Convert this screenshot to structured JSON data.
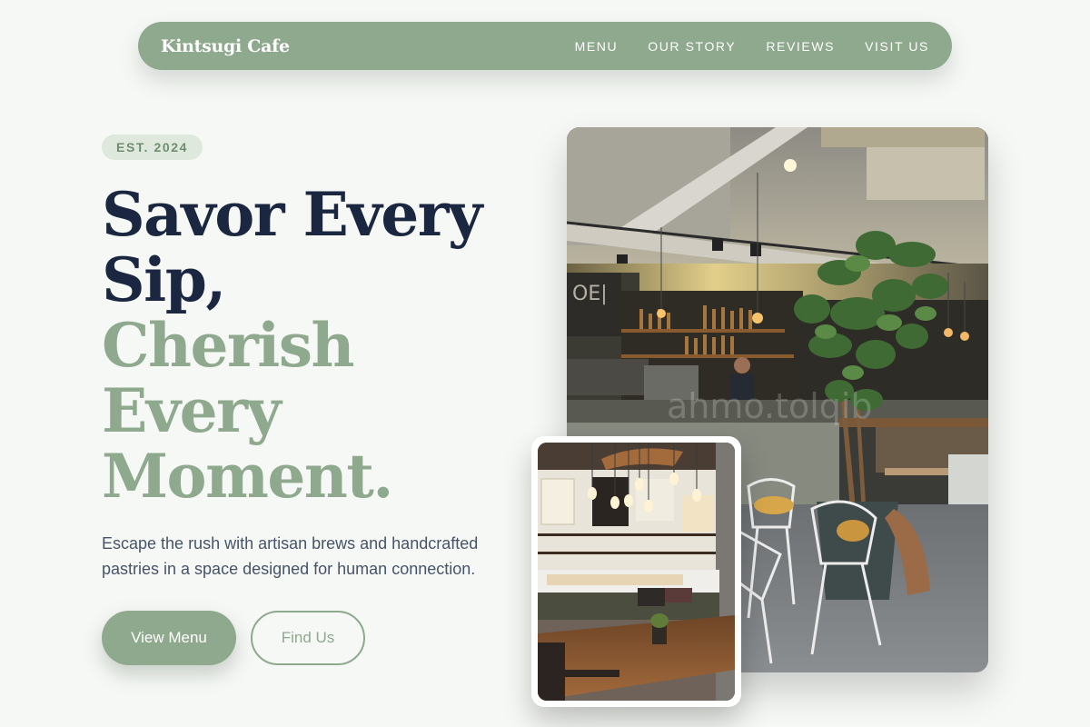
{
  "nav": {
    "brand": "Kintsugi Cafe",
    "links": [
      "MENU",
      "OUR STORY",
      "REVIEWS",
      "VISIT US"
    ]
  },
  "hero": {
    "badge": "EST. 2024",
    "headline_dark": "Savor Every Sip,",
    "headline_green": "Cherish Every Moment.",
    "subtext": "Escape the rush with artisan brews and handcrafted pastries in a space designed for human connection.",
    "primary_button": "View Menu",
    "secondary_button": "Find Us"
  },
  "colors": {
    "sage": "#8ea98d",
    "navy": "#1b2741",
    "background": "#f6f8f5"
  }
}
